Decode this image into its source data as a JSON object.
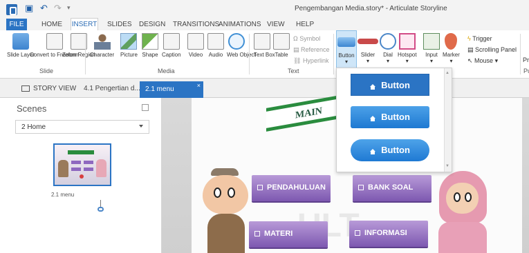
{
  "title_bar": {
    "window_title": "Pengembangan Media.story* - Articulate Storyline",
    "quick_access": [
      "save-icon",
      "undo-icon",
      "redo-icon",
      "customize-icon"
    ]
  },
  "menu_bar": {
    "items": [
      "FILE",
      "HOME",
      "INSERT",
      "SLIDES",
      "DESIGN",
      "TRANSITIONS",
      "ANIMATIONS",
      "VIEW",
      "HELP"
    ],
    "active": "INSERT"
  },
  "ribbon": {
    "slide_group": {
      "label": "Slide",
      "buttons": [
        {
          "label": "Slide Layer",
          "icon": "slide-layer-icon"
        },
        {
          "label": "Convert to Freeform",
          "icon": "freeform-icon"
        },
        {
          "label": "Zoom Region",
          "icon": "zoom-region-icon"
        }
      ]
    },
    "media_group": {
      "label": "Media",
      "buttons": [
        {
          "label": "Character",
          "icon": "character-icon"
        },
        {
          "label": "Picture",
          "icon": "picture-icon"
        },
        {
          "label": "Shape",
          "icon": "shape-icon"
        },
        {
          "label": "Caption",
          "icon": "caption-icon"
        },
        {
          "label": "Video",
          "icon": "video-icon"
        },
        {
          "label": "Audio",
          "icon": "audio-icon"
        },
        {
          "label": "Web Object",
          "icon": "web-object-icon"
        }
      ]
    },
    "text_group": {
      "label": "Text",
      "buttons": [
        {
          "label": "Text Box",
          "icon": "text-box-icon"
        },
        {
          "label": "Table",
          "icon": "table-icon"
        }
      ],
      "small": [
        "Symbol",
        "Reference",
        "Hyperlink"
      ]
    },
    "interactive_group": {
      "buttons": [
        {
          "label": "Button",
          "icon": "button-icon"
        },
        {
          "label": "Slider",
          "icon": "slider-icon"
        },
        {
          "label": "Dial",
          "icon": "dial-icon"
        },
        {
          "label": "Hotspot",
          "icon": "hotspot-icon"
        },
        {
          "label": "Input",
          "icon": "input-icon"
        },
        {
          "label": "Marker",
          "icon": "marker-icon"
        }
      ],
      "small": [
        "Trigger",
        "Scrolling Panel",
        "Mouse"
      ],
      "trailing": [
        "Pr",
        "Pu"
      ]
    }
  },
  "tabs": {
    "story_view": "STORY VIEW",
    "tab_1": "4.1 Pengertian d...",
    "tab_2": "2.1 menu"
  },
  "left_panel": {
    "scenes_label": "Scenes",
    "scene_select": "2 Home",
    "thumbnail_label": "2.1 menu"
  },
  "stage": {
    "banner": "MAIN",
    "buttons": [
      "PENDAHULUAN",
      "BANK SOAL",
      "MATERI",
      "INFORMASI"
    ]
  },
  "button_dropdown": {
    "options": [
      "Button",
      "Button",
      "Button"
    ],
    "colors": [
      "#2b74c4",
      "#1e83d6",
      "#2f83d8"
    ]
  },
  "colors": {
    "accent": "#2b74c4",
    "menu_button": "#8f6bc0",
    "banner_green": "#2a8c3e"
  }
}
